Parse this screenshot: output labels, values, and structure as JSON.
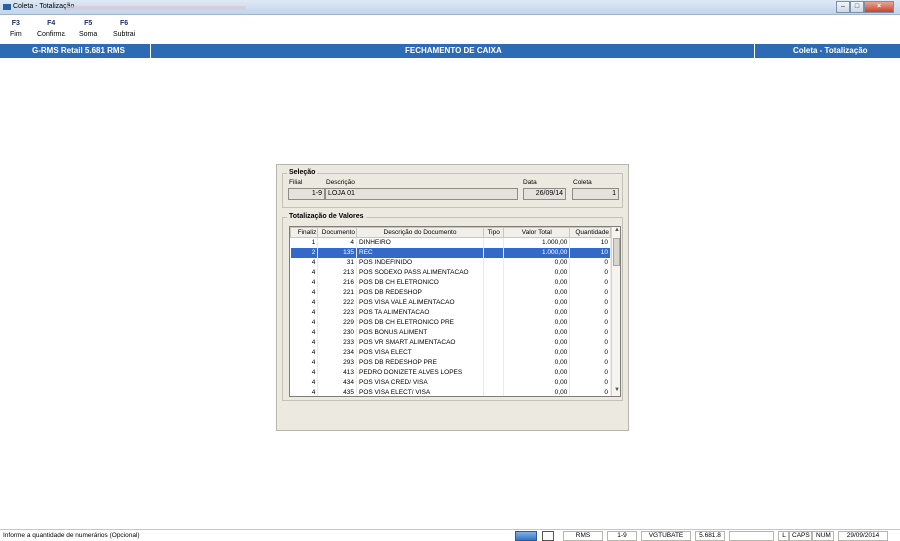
{
  "window": {
    "title": "Coleta - Totalização"
  },
  "toolbar": [
    {
      "key": "F3",
      "label": "Fim"
    },
    {
      "key": "F4",
      "label": "Confirma"
    },
    {
      "key": "F5",
      "label": "Soma"
    },
    {
      "key": "F6",
      "label": "Subtrai"
    }
  ],
  "header": {
    "left": "G-RMS Retail 5.681 RMS",
    "center": "FECHAMENTO DE CAIXA",
    "right": "Coleta - Totalização",
    "color": "#2d6bb5"
  },
  "selecao": {
    "legend": "Seleção",
    "filial_label": "Filial",
    "filial_value": "1-9",
    "descricao_label": "Descrição",
    "descricao_value": "LOJA 01",
    "data_label": "Data",
    "data_value": "26/09/14",
    "coleta_label": "Coleta",
    "coleta_value": "1"
  },
  "totalizacao": {
    "legend": "Totalização de Valores",
    "columns": [
      "Finaliz",
      "Documento",
      "Descrição do Documento",
      "Tipo",
      "Valor Total",
      "Quantidade"
    ],
    "selected_row": 1,
    "rows": [
      [
        "1",
        "4",
        "DINHEIRO",
        "",
        "1.000,00",
        "10"
      ],
      [
        "2",
        "135",
        "REC",
        "",
        "1.000,00",
        "10"
      ],
      [
        "4",
        "31",
        "POS INDEFINIDO",
        "",
        "0,00",
        "0"
      ],
      [
        "4",
        "213",
        "POS SODEXO PASS ALIMENTACAO",
        "",
        "0,00",
        "0"
      ],
      [
        "4",
        "216",
        "POS DB CH ELETRONICO",
        "",
        "0,00",
        "0"
      ],
      [
        "4",
        "221",
        "POS DB REDESHOP",
        "",
        "0,00",
        "0"
      ],
      [
        "4",
        "222",
        "POS VISA VALE ALIMENTACAO",
        "",
        "0,00",
        "0"
      ],
      [
        "4",
        "223",
        "POS TA ALIMENTACAO",
        "",
        "0,00",
        "0"
      ],
      [
        "4",
        "229",
        "POS DB CH ELETRONICO PRE",
        "",
        "0,00",
        "0"
      ],
      [
        "4",
        "230",
        "POS BONUS ALIMENT",
        "",
        "0,00",
        "0"
      ],
      [
        "4",
        "233",
        "POS VR SMART ALIMENTACAO",
        "",
        "0,00",
        "0"
      ],
      [
        "4",
        "234",
        "POS VISA ELECT",
        "",
        "0,00",
        "0"
      ],
      [
        "4",
        "293",
        "POS DB REDESHOP PRE",
        "",
        "0,00",
        "0"
      ],
      [
        "4",
        "413",
        "PEDRO DONIZETE ALVES LOPES",
        "",
        "0,00",
        "0"
      ],
      [
        "4",
        "434",
        "POS VISA CRED/ VISA",
        "",
        "0,00",
        "0"
      ],
      [
        "4",
        "435",
        "POS VISA ELECT/ VISA",
        "",
        "0,00",
        "0"
      ]
    ]
  },
  "statusbar": {
    "message": "Informe a quantidade de numerários (Opcional)",
    "cells": [
      "RMS",
      "1-9",
      "VGTUBATE",
      "5.681.8",
      "",
      "L",
      "CAPS",
      "NUM",
      "29/09/2014"
    ]
  }
}
